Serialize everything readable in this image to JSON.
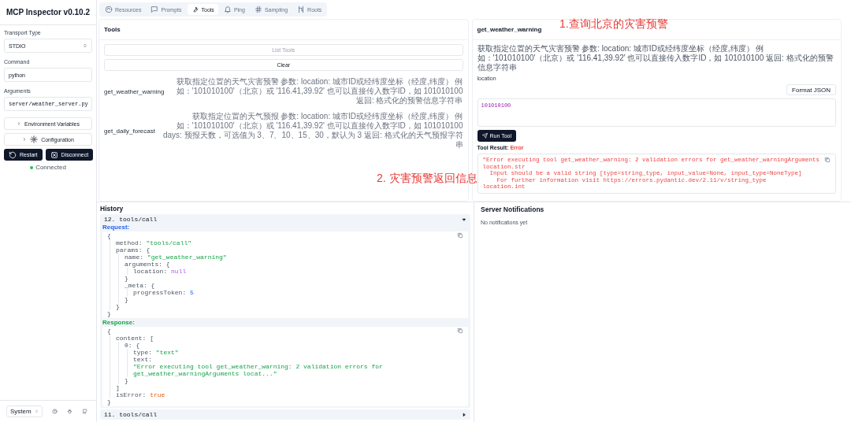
{
  "sidebar": {
    "title": "MCP Inspector v0.10.2",
    "fields": [
      {
        "label": "Transport Type",
        "kind": "select",
        "value": "STDIO"
      },
      {
        "label": "Command",
        "kind": "input",
        "value": "python"
      },
      {
        "label": "Arguments",
        "kind": "input",
        "value": "server/weather_server.py"
      }
    ],
    "toggles": [
      {
        "label": "Environment Variables",
        "expanded": false
      },
      {
        "label": "Configuration",
        "expanded": false
      }
    ],
    "actions": [
      {
        "label": "Restart"
      },
      {
        "label": "Disconnect"
      }
    ],
    "status": {
      "label": "Connected",
      "color": "#22c55e"
    },
    "theme": "System"
  },
  "tabs": [
    {
      "label": "Resources",
      "selected": false
    },
    {
      "label": "Prompts",
      "selected": false
    },
    {
      "label": "Tools",
      "selected": true
    },
    {
      "label": "Ping",
      "selected": false
    },
    {
      "label": "Sampling",
      "selected": false
    },
    {
      "label": "Roots",
      "selected": false
    }
  ],
  "tools_panel": {
    "title": "Tools",
    "list_button": {
      "label": "List Tools",
      "disabled": true
    },
    "clear_button": "Clear",
    "tools": [
      {
        "name": "get_weather_warning",
        "description": "获取指定位置的天气灾害预警 参数: location: 城市ID或经纬度坐标（经度,纬度） 例如：'101010100'（北京）或 '116.41,39.92' 也可以直接传入数字ID，如 101010100 返回: 格式化的预警信息字符串"
      },
      {
        "name": "get_daily_forecast",
        "description": "获取指定位置的天气预报 参数: location: 城市ID或经纬度坐标（经度,纬度） 例如：'101010100'（北京）或 '116.41,39.92' 也可以直接传入数字ID，如 101010100 days: 预报天数，可选值为 3、7、10、15、30，默认为 3 返回: 格式化的天气预报字符串"
      }
    ]
  },
  "tool_detail": {
    "title": "get_weather_warning",
    "description": "获取指定位置的天气灾害预警 参数: location: 城市ID或经纬度坐标（经度,纬度） 例如：'101010100'（北京）或 '116.41,39.92' 也可以直接传入数字ID，如 101010100 返回: 格式化的预警信息字符串",
    "param_label": "location",
    "format_button": "Format JSON",
    "value": "101010100",
    "run_button": "Run Tool",
    "result_label": "Tool Result:",
    "result_status": "Error",
    "result_lines": [
      "\"Error executing tool get_weather_warning: 2 validation errors for get_weather_warningArguments",
      "location.str",
      "  Input should be a valid string [type=string_type, input_value=None, input_type=NoneType]",
      "    For further information visit https://errors.pydantic.dev/2.11/v/string_type",
      "location.int"
    ]
  },
  "history": {
    "title": "History",
    "entries": [
      {
        "title": "12. tools/call",
        "expanded": true,
        "request_label": "Request:",
        "request": {
          "open": "{",
          "close": "}",
          "children": [
            {
              "key": "method:",
              "value": "\"tools/call\"",
              "kind": "string"
            },
            {
              "key": "params:",
              "open": "{",
              "close": "}",
              "children": [
                {
                  "key": "name:",
                  "value": "\"get_weather_warning\"",
                  "kind": "string"
                },
                {
                  "key": "arguments:",
                  "open": "{",
                  "close": "}",
                  "children": [
                    {
                      "key": "location:",
                      "value": "null",
                      "kind": "null"
                    }
                  ]
                },
                {
                  "key": "_meta:",
                  "open": "{",
                  "close": "}",
                  "children": [
                    {
                      "key": "progressToken:",
                      "value": "5",
                      "kind": "number"
                    }
                  ]
                }
              ]
            }
          ]
        },
        "response_label": "Response:",
        "response": {
          "open": "{",
          "close": "}",
          "children": [
            {
              "key": "content:",
              "open": "[",
              "close": "]",
              "children": [
                {
                  "key": "0:",
                  "open": "{",
                  "close": "}",
                  "children": [
                    {
                      "key": "type:",
                      "value": "\"text\"",
                      "kind": "string"
                    },
                    {
                      "key": "text:",
                      "value": "\"Error executing tool get_weather_warning: 2 validation errors for get_weather_warningArguments locat...\"",
                      "kind": "string"
                    }
                  ]
                }
              ]
            },
            {
              "key": "isError:",
              "value": "true",
              "kind": "boolean"
            }
          ]
        }
      },
      {
        "title": "11. tools/call",
        "expanded": false
      }
    ]
  },
  "notifications": {
    "title": "Server Notifications",
    "empty_text": "No notifications yet"
  },
  "annotations": [
    {
      "text": "1.查询北京的灾害预警"
    },
    {
      "text": "2. 灾害预警返回信息"
    }
  ]
}
